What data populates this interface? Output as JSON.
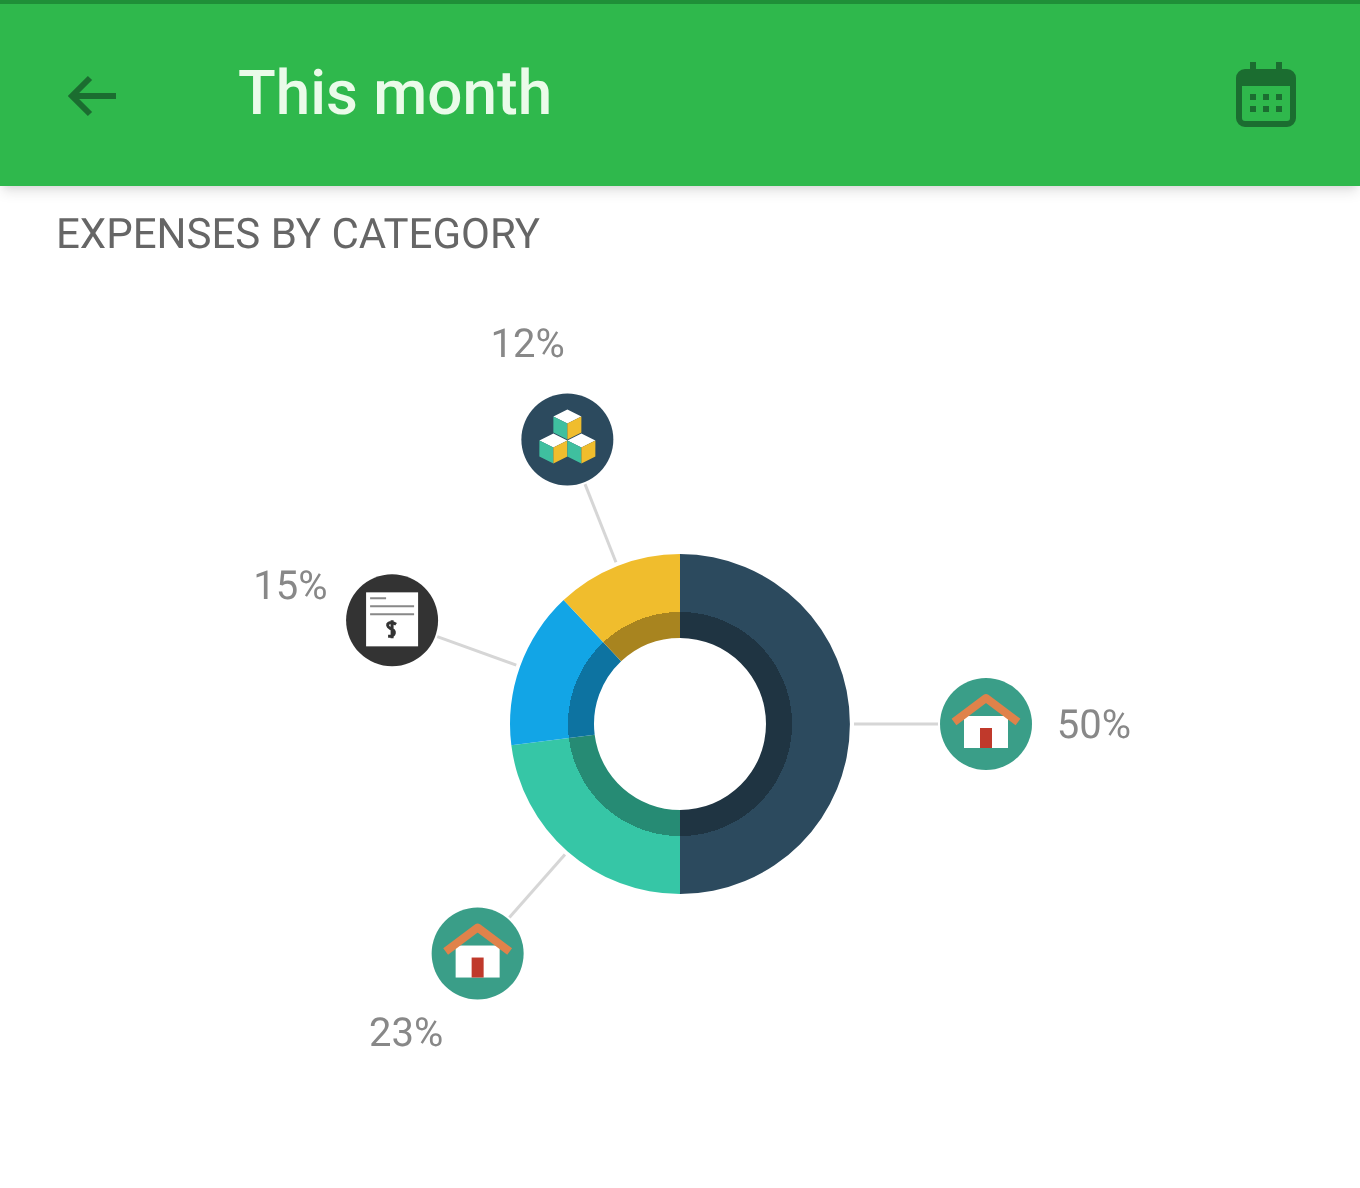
{
  "app_bar": {
    "title": "This month"
  },
  "section_title": "EXPENSES BY CATEGORY",
  "chart_data": {
    "type": "donut",
    "values": [
      50,
      23,
      15,
      12
    ]
  },
  "slices": [
    {
      "label": "50%",
      "color": "#2c4a5e",
      "kind": "house"
    },
    {
      "label": "23%",
      "color": "#36c6a6",
      "kind": "house"
    },
    {
      "label": "15%",
      "color": "#12a5e6",
      "kind": "receipt"
    },
    {
      "label": "12%",
      "color": "#f0bd2d",
      "kind": "boxes"
    }
  ]
}
